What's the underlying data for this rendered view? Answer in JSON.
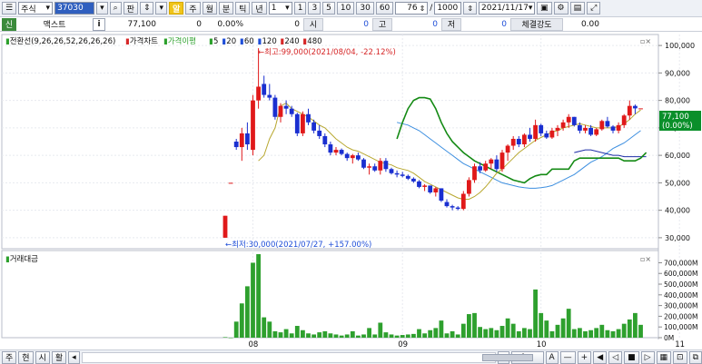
{
  "toolbar": {
    "market": "주식",
    "code": "37030",
    "search_btn": "판",
    "badge": "알",
    "periods": [
      "주",
      "월",
      "분",
      "틱",
      "년"
    ],
    "interval_value": "1",
    "interval_quick": [
      "1",
      "3",
      "5",
      "10",
      "30",
      "60"
    ],
    "count_value": "76",
    "separator": "/",
    "count_max": "1000",
    "date": "2021/11/17"
  },
  "info": {
    "tag": "신",
    "name": "맥스트",
    "i_mark": "i",
    "price": "77,100",
    "change": "0",
    "rate": "0.00%",
    "volume": "0",
    "open_label": "시",
    "open": "0",
    "high_label": "고",
    "high": "0",
    "low_label": "저",
    "low": "0",
    "strength_label": "체결강도",
    "strength": "0.00"
  },
  "price_panel": {
    "legend_ichimoku": "전환선(9,26,26,52,26,26,26)",
    "legend_price": "가격차트",
    "legend_env": "가격이평",
    "ma_labels": [
      "5",
      "20",
      "60",
      "120",
      "240",
      "480"
    ],
    "ma_colors": [
      "#2ca02c",
      "#1f4ed8",
      "#1f4ed8",
      "#1f4ed8",
      "#d62728",
      "#d62728"
    ],
    "high_annotation": "←최고:99,000(2021/08/04, -22.12%)",
    "low_annotation": "←최저:30,000(2021/07/27, +157.00%)",
    "current_price": "77,100",
    "current_rate": "(0.00%)"
  },
  "volume_panel": {
    "legend": "거래대금"
  },
  "bottom": {
    "tabs": [
      "주",
      "현",
      "시",
      "활"
    ]
  },
  "chart_data": {
    "type": "candlestick",
    "price_axis": {
      "ticks": [
        "100,000",
        "90,000",
        "80,000",
        "70,000",
        "60,000",
        "50,000",
        "40,000",
        "30,000"
      ],
      "ylim": [
        26000,
        104000
      ]
    },
    "volume_axis": {
      "ticks": [
        "700,000M",
        "600,000M",
        "500,000M",
        "400,000M",
        "300,000M",
        "200,000M",
        "100,000M",
        "0M"
      ],
      "ylim": [
        0,
        780000
      ]
    },
    "x_labels": [
      "08",
      "09",
      "10",
      "11"
    ],
    "x_label_index": [
      5,
      32,
      57,
      82
    ],
    "candles": [
      [
        30000,
        38000,
        30000,
        38000
      ],
      [
        50000,
        50000,
        50000,
        50000
      ],
      [
        65000,
        66000,
        62000,
        63000
      ],
      [
        63000,
        70000,
        58000,
        68000
      ],
      [
        68000,
        72000,
        62000,
        64000
      ],
      [
        62000,
        82000,
        60000,
        80000
      ],
      [
        80000,
        99000,
        77000,
        85000
      ],
      [
        86000,
        89000,
        81000,
        82000
      ],
      [
        82000,
        86000,
        80000,
        81000
      ],
      [
        81000,
        82000,
        73000,
        74000
      ],
      [
        74000,
        79000,
        72000,
        78000
      ],
      [
        78000,
        80000,
        75000,
        77000
      ],
      [
        77000,
        78000,
        74000,
        75000
      ],
      [
        75000,
        75500,
        67000,
        68000
      ],
      [
        68000,
        76000,
        67000,
        75000
      ],
      [
        75000,
        77000,
        71000,
        72000
      ],
      [
        72000,
        73000,
        68000,
        69000
      ],
      [
        69000,
        71000,
        66000,
        67000
      ],
      [
        67000,
        68000,
        63000,
        64000
      ],
      [
        64000,
        65000,
        60000,
        61000
      ],
      [
        61000,
        63000,
        60000,
        62000
      ],
      [
        62000,
        62500,
        60000,
        60500
      ],
      [
        60500,
        61000,
        58000,
        59000
      ],
      [
        59000,
        60500,
        57000,
        60000
      ],
      [
        60000,
        61000,
        58000,
        58500
      ],
      [
        58500,
        59000,
        55000,
        55500
      ],
      [
        55500,
        57000,
        53000,
        56000
      ],
      [
        56000,
        57000,
        54000,
        54500
      ],
      [
        54500,
        59000,
        53000,
        58000
      ],
      [
        58000,
        59000,
        54000,
        55000
      ],
      [
        55000,
        55500,
        53000,
        53500
      ],
      [
        53500,
        54500,
        52000,
        53000
      ],
      [
        53000,
        54000,
        52000,
        52500
      ],
      [
        52500,
        53000,
        51000,
        51500
      ],
      [
        51500,
        52000,
        50000,
        50500
      ],
      [
        50500,
        51000,
        48000,
        48500
      ],
      [
        48500,
        49500,
        47000,
        49000
      ],
      [
        49000,
        49000,
        46000,
        46500
      ],
      [
        46500,
        48500,
        45000,
        48000
      ],
      [
        48000,
        48000,
        43000,
        43500
      ],
      [
        43000,
        44000,
        41000,
        41500
      ],
      [
        41500,
        42000,
        40000,
        41000
      ],
      [
        41000,
        41500,
        40000,
        40500
      ],
      [
        40500,
        47000,
        40000,
        46000
      ],
      [
        46000,
        52000,
        45000,
        51000
      ],
      [
        51000,
        57000,
        50000,
        56000
      ],
      [
        56000,
        57500,
        53500,
        54500
      ],
      [
        54500,
        58000,
        54000,
        57000
      ],
      [
        57000,
        59000,
        55000,
        58500
      ],
      [
        58500,
        60000,
        54000,
        55000
      ],
      [
        55000,
        62000,
        54000,
        61000
      ],
      [
        61000,
        64000,
        58000,
        63500
      ],
      [
        63500,
        67000,
        62000,
        66000
      ],
      [
        66000,
        67000,
        63000,
        64000
      ],
      [
        64000,
        68000,
        63000,
        67500
      ],
      [
        67500,
        70000,
        65000,
        66000
      ],
      [
        66000,
        73000,
        65000,
        71000
      ],
      [
        71000,
        71500,
        67000,
        68000
      ],
      [
        68000,
        69000,
        66000,
        66500
      ],
      [
        66500,
        70000,
        66000,
        69000
      ],
      [
        69000,
        71000,
        67000,
        70000
      ],
      [
        70000,
        73000,
        69000,
        72000
      ],
      [
        72000,
        75000,
        70000,
        74000
      ],
      [
        74000,
        74000,
        70500,
        71000
      ],
      [
        71000,
        72000,
        68000,
        69000
      ],
      [
        69000,
        71000,
        68000,
        70000
      ],
      [
        70000,
        71000,
        67000,
        67500
      ],
      [
        67500,
        70000,
        67000,
        69500
      ],
      [
        69500,
        73000,
        69000,
        72500
      ],
      [
        72500,
        74000,
        70000,
        70500
      ],
      [
        70500,
        71000,
        68000,
        69000
      ],
      [
        69000,
        72000,
        68000,
        71000
      ],
      [
        71000,
        75000,
        70000,
        74500
      ],
      [
        74500,
        80000,
        73000,
        78000
      ],
      [
        78000,
        78500,
        75000,
        77100
      ],
      [
        77100,
        77100,
        77100,
        77100
      ]
    ],
    "volume": [
      5000,
      0,
      150000,
      320000,
      480000,
      700000,
      780000,
      190000,
      150000,
      60000,
      50000,
      80000,
      40000,
      110000,
      70000,
      40000,
      30000,
      50000,
      60000,
      40000,
      30000,
      20000,
      30000,
      60000,
      20000,
      30000,
      90000,
      30000,
      140000,
      50000,
      30000,
      20000,
      25000,
      30000,
      35000,
      80000,
      40000,
      70000,
      90000,
      160000,
      40000,
      60000,
      30000,
      130000,
      220000,
      230000,
      100000,
      80000,
      90000,
      70000,
      110000,
      180000,
      130000,
      60000,
      90000,
      80000,
      450000,
      230000,
      160000,
      60000,
      120000,
      180000,
      270000,
      80000,
      90000,
      60000,
      70000,
      90000,
      120000,
      70000,
      60000,
      80000,
      130000,
      170000,
      230000,
      120000
    ],
    "ma5": [
      null,
      null,
      null,
      null,
      null,
      null,
      58000,
      60000,
      66000,
      70000,
      78000,
      79000,
      77000,
      76000,
      75000,
      74000,
      72500,
      71000,
      70000,
      68000,
      66000,
      64500,
      63000,
      62000,
      61500,
      60500,
      59500,
      58500,
      57500,
      57000,
      56500,
      55500,
      55000,
      54500,
      53500,
      52000,
      50500,
      49500,
      48500,
      47500,
      46500,
      45500,
      44500,
      44000,
      44000,
      45000,
      46500,
      48500,
      51000,
      53500,
      55000,
      57000,
      59000,
      61000,
      62500,
      64000,
      65500,
      66500,
      67500,
      68500,
      69000,
      70000,
      70500,
      71000,
      71500,
      71000,
      70500,
      70000,
      70000,
      70000,
      70000,
      70500,
      71500,
      73000,
      75000,
      76500
    ],
    "ma20": [
      null,
      null,
      null,
      null,
      null,
      null,
      null,
      null,
      null,
      null,
      null,
      null,
      null,
      null,
      null,
      null,
      null,
      null,
      null,
      null,
      null,
      null,
      null,
      null,
      null,
      null,
      null,
      null,
      null,
      null,
      null,
      null,
      null,
      null,
      null,
      null,
      null,
      null,
      null,
      null,
      null,
      null,
      null,
      null,
      null,
      null,
      null,
      null,
      null,
      null,
      null,
      null,
      null,
      null,
      null,
      null,
      null,
      null,
      null,
      null,
      null,
      null,
      null,
      null,
      null,
      null,
      null,
      null,
      null,
      null,
      null,
      null,
      null,
      null,
      null,
      null
    ],
    "ma_blue": [
      null,
      null,
      null,
      null,
      null,
      null,
      null,
      null,
      null,
      null,
      null,
      null,
      null,
      null,
      null,
      null,
      null,
      null,
      null,
      null,
      null,
      null,
      null,
      null,
      null,
      null,
      null,
      null,
      null,
      null,
      null,
      72000,
      71500,
      71000,
      70000,
      69000,
      67500,
      66000,
      64500,
      63000,
      61500,
      60000,
      58500,
      57000,
      56000,
      55000,
      54000,
      53000,
      52000,
      51000,
      50000,
      49500,
      49000,
      48500,
      48200,
      48000,
      48000,
      48200,
      48500,
      49000,
      50000,
      51000,
      52000,
      53000,
      54500,
      56000,
      57500,
      58500,
      59500,
      61000,
      62500,
      63500,
      64500,
      66000,
      67500,
      69000
    ],
    "span_green": [
      null,
      null,
      null,
      null,
      null,
      null,
      null,
      null,
      null,
      null,
      null,
      null,
      null,
      null,
      null,
      null,
      null,
      null,
      null,
      null,
      null,
      null,
      null,
      null,
      null,
      null,
      null,
      null,
      null,
      null,
      null,
      66000,
      72000,
      77000,
      80000,
      81000,
      81000,
      80500,
      77000,
      72000,
      68000,
      65000,
      63000,
      61000,
      59500,
      58000,
      57000,
      56000,
      55000,
      54000,
      53000,
      52000,
      51000,
      50500,
      50000,
      51500,
      52500,
      53000,
      53000,
      55000,
      55000,
      55000,
      55000,
      58000,
      59000,
      59000,
      59000,
      59000,
      59000,
      59000,
      59000,
      59000,
      58000,
      58000,
      58000,
      59000,
      61000
    ],
    "span_blue": [
      null,
      null,
      null,
      null,
      null,
      null,
      null,
      null,
      null,
      null,
      null,
      null,
      null,
      null,
      null,
      null,
      null,
      null,
      null,
      null,
      null,
      null,
      null,
      null,
      null,
      null,
      null,
      null,
      null,
      null,
      null,
      null,
      null,
      null,
      null,
      null,
      null,
      null,
      null,
      null,
      null,
      null,
      null,
      null,
      null,
      null,
      null,
      null,
      null,
      null,
      null,
      null,
      null,
      null,
      null,
      null,
      null,
      null,
      null,
      null,
      null,
      null,
      null,
      61000,
      61500,
      62000,
      62000,
      61500,
      61000,
      60500,
      60000,
      60000,
      59500,
      59500,
      59500,
      59500,
      59500
    ]
  }
}
